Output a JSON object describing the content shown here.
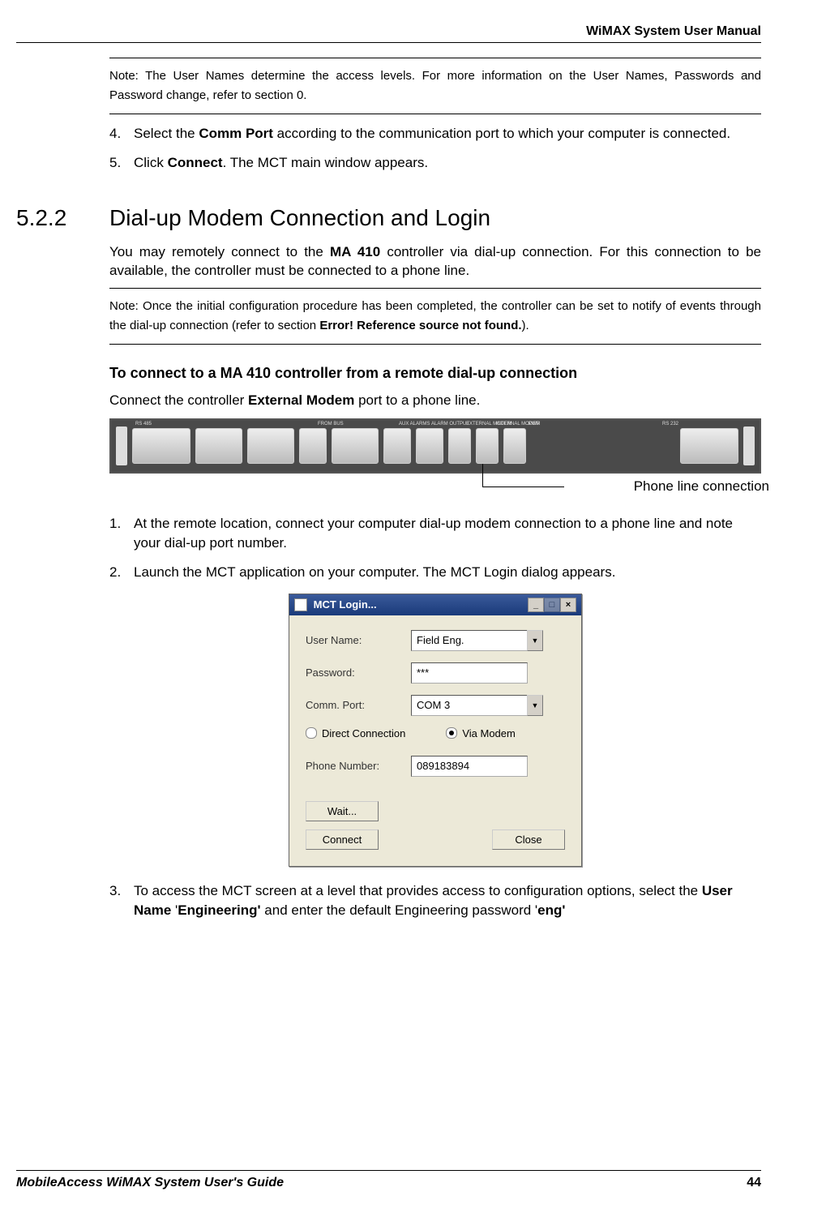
{
  "header": {
    "title": "WiMAX System User Manual"
  },
  "note1": {
    "text": "Note: The User Names determine the access levels. For more information on the User Names, Passwords and Password change, refer to section 0."
  },
  "step4": {
    "num": "4.",
    "pre": "Select the ",
    "bold": "Comm Port",
    "post": " according to the communication port to which your computer is connected."
  },
  "step5": {
    "num": "5.",
    "pre": "Click ",
    "bold": "Connect",
    "post": ". The MCT main window appears."
  },
  "section": {
    "num": "5.2.2",
    "title": "Dial-up Modem Connection and Login"
  },
  "para1": {
    "pre": "You may remotely connect to the ",
    "bold": "MA 410",
    "post": " controller via dial-up connection.  For this connection to be available, the controller must be connected to a phone line."
  },
  "note2": {
    "pre": "Note: Once the initial configuration procedure has been completed, the controller can be set to notify of events through the dial-up connection (refer to section ",
    "bold": "Error! Reference source not found.",
    "post": ")."
  },
  "subheading": "To connect to a MA 410 controller from a remote dial-up connection",
  "connect_line": {
    "pre": "Connect the controller ",
    "bold": "External Modem",
    "post": " port to a phone line."
  },
  "device_labels": {
    "rs485": "RS 485",
    "from_bus": "FROM BUS",
    "aux": "AUX ALARMS",
    "alarm": "ALARM OUTPUT",
    "ext": "EXTERNAL MODEM",
    "int": "INTERNAL MODEM",
    "pwr": "PWR",
    "rs232": "RS 232"
  },
  "phone_label": "Phone line connection",
  "step_r1": {
    "num": "1.",
    "text": "At the remote location, connect your computer dial-up modem connection to a phone line and note your dial-up port number."
  },
  "step_r2": {
    "num": "2.",
    "text": "Launch the MCT application on your computer. The MCT Login dialog appears."
  },
  "dialog": {
    "title": "MCT Login...",
    "user_label": "User Name:",
    "user_value": "Field Eng.",
    "pass_label": "Password:",
    "pass_value": "***",
    "comm_label": "Comm. Port:",
    "comm_value": "COM 3",
    "radio_direct": "Direct Connection",
    "radio_modem": "Via Modem",
    "phone_label": "Phone Number:",
    "phone_value": "089183894",
    "wait_btn": "Wait...",
    "connect_btn": "Connect",
    "close_btn": "Close"
  },
  "step_r3": {
    "num": "3.",
    "pre": "To access the MCT screen at a level that provides access to configuration options, select the ",
    "b1": "User Name",
    "mid1": " '",
    "b2": "Engineering'",
    "mid2": " and enter the default Engineering password '",
    "b3": "eng'",
    "post": ""
  },
  "footer": {
    "left": "MobileAccess WiMAX System User's Guide",
    "page": "44"
  }
}
